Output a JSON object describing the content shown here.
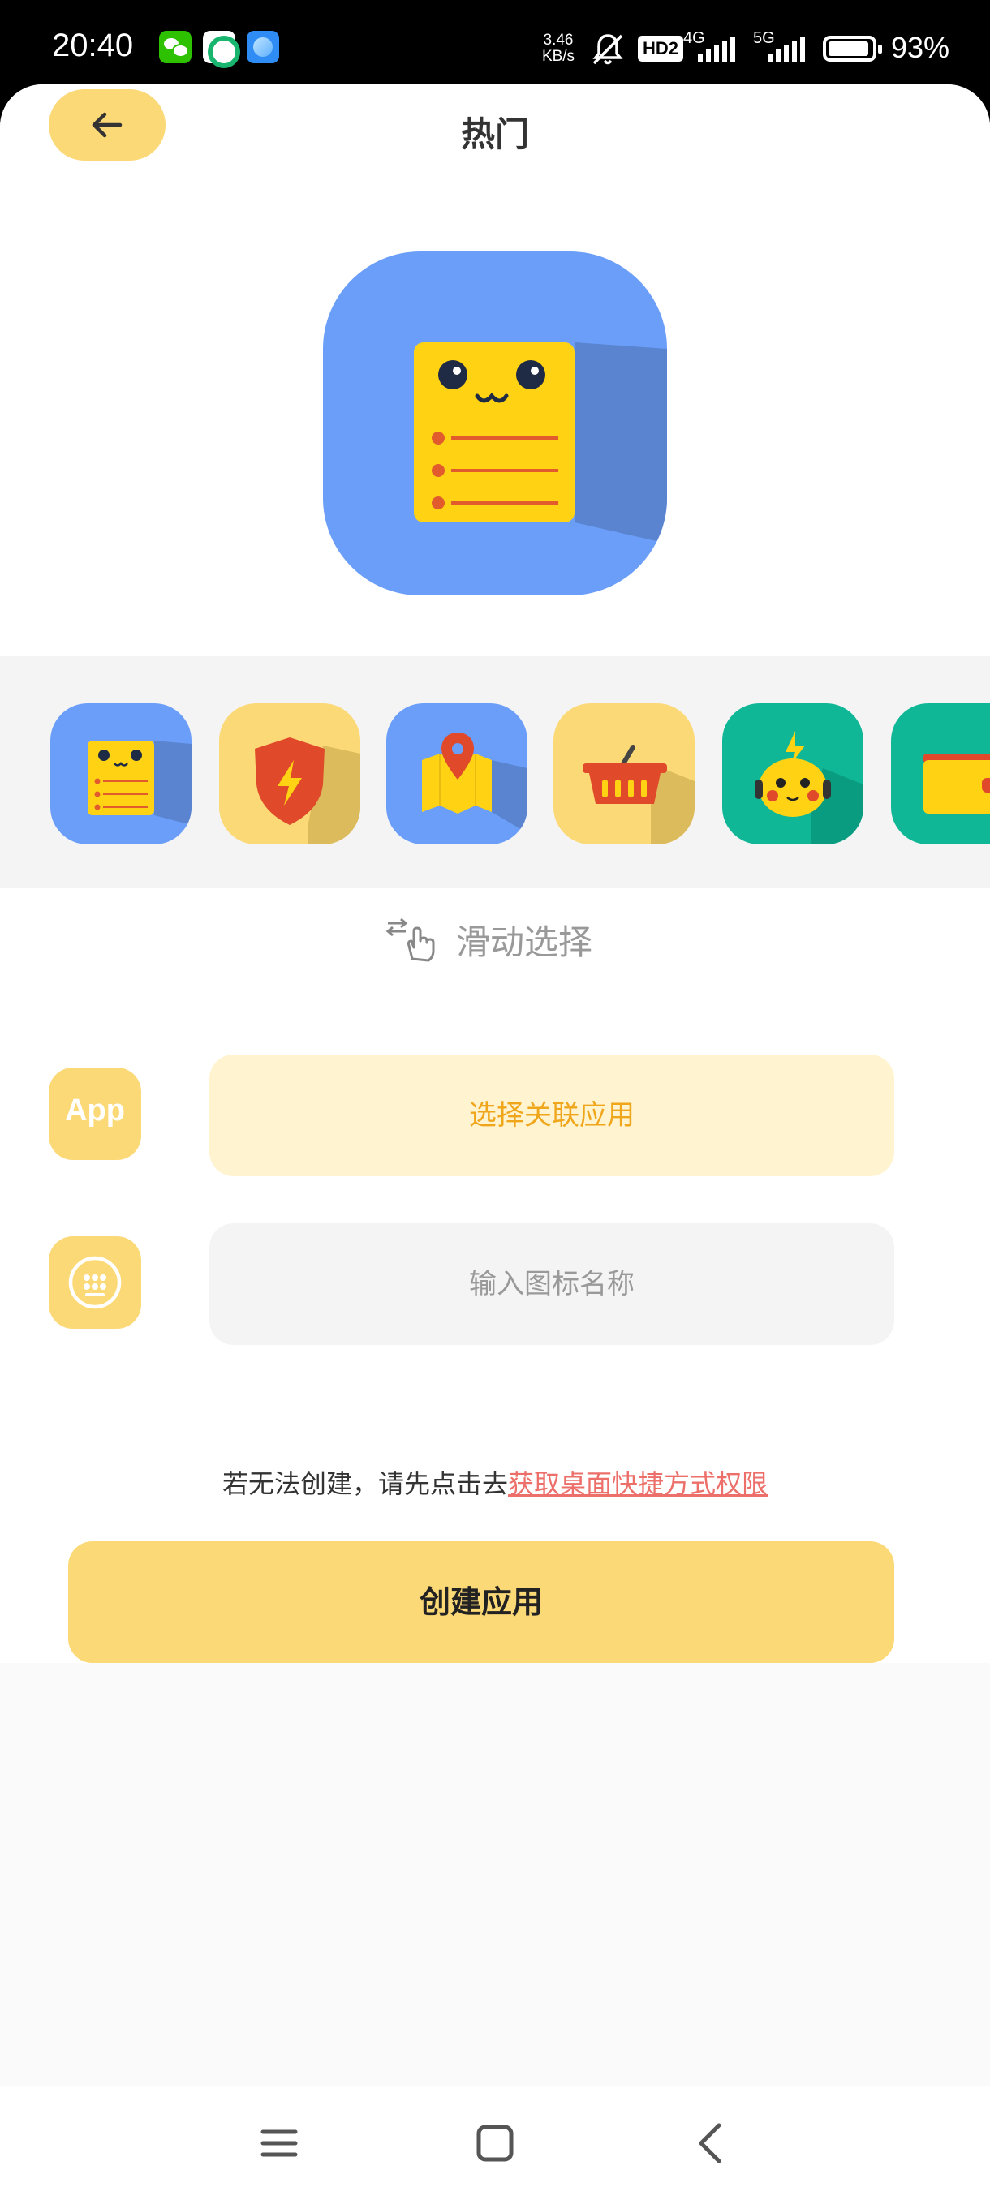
{
  "status_bar": {
    "time": "20:40",
    "app_icons": [
      "wechat-icon",
      "green-app-icon",
      "browser-icon"
    ],
    "speed_value": "3.46",
    "speed_unit": "KB/s",
    "hd_label": "HD2",
    "net1_label": "4G",
    "net2_label": "5G",
    "battery": "93%"
  },
  "header": {
    "title": "热门",
    "back_icon": "arrow-left-icon"
  },
  "hero": {
    "icon": "notepad-face-icon"
  },
  "icon_strip": {
    "items": [
      {
        "icon": "notepad-face-icon",
        "bg": "#6a9ef9"
      },
      {
        "icon": "shield-bolt-icon",
        "bg": "#fcd977"
      },
      {
        "icon": "map-pin-icon",
        "bg": "#6a9ef9"
      },
      {
        "icon": "basket-icon",
        "bg": "#fcd977"
      },
      {
        "icon": "pikachu-icon",
        "bg": "#10b797"
      },
      {
        "icon": "wallet-icon",
        "bg": "#10b797"
      }
    ]
  },
  "hint": {
    "text": "滑动选择",
    "icon": "swipe-hand-icon"
  },
  "form": {
    "app_badge_label": "App",
    "select_app_label": "选择关联应用",
    "name_placeholder": "输入图标名称",
    "name_icon": "keypad-icon"
  },
  "notice": {
    "prefix": "若无法创建，请先点击去",
    "link": "获取桌面快捷方式权限"
  },
  "create_button": "创建应用",
  "nav": [
    "menu-icon",
    "home-square-icon",
    "back-chevron-icon"
  ],
  "colors": {
    "accent_yellow": "#fcd977",
    "accent_blue": "#6a9ef9",
    "accent_green": "#10b797",
    "link_red": "#ec6f6a",
    "select_text": "#f0a61a"
  }
}
